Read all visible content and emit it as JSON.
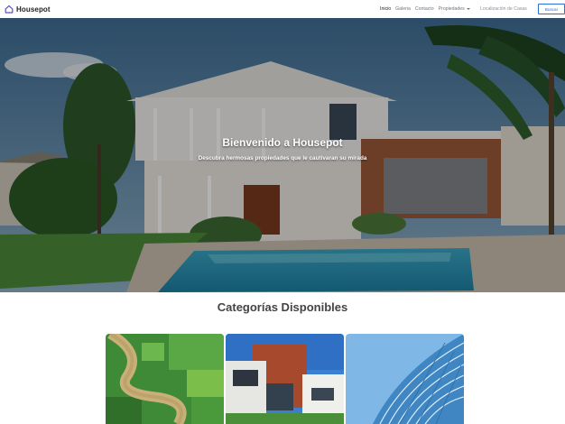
{
  "navbar": {
    "brand_icon": "house-icon",
    "brand": "Housepot",
    "links": {
      "inicio": "Inicio",
      "galeria": "Galeria",
      "contacto": "Contacto",
      "propiedades": "Propiedades"
    },
    "search_placeholder": "Localización de Casas",
    "search_button": "Buscar",
    "accent_color": "#2a6fd6"
  },
  "hero": {
    "title": "Bienvenido a Housepot",
    "subtitle": "Descubra hermosas propiedades que le cautivaran su mirada",
    "image": "house-with-pool-photo"
  },
  "categories": {
    "title": "Categorías Disponibles",
    "cards": [
      {
        "image": "aerial-farmland-river-photo"
      },
      {
        "image": "modern-house-photo"
      },
      {
        "image": "glass-office-building-photo"
      }
    ]
  }
}
